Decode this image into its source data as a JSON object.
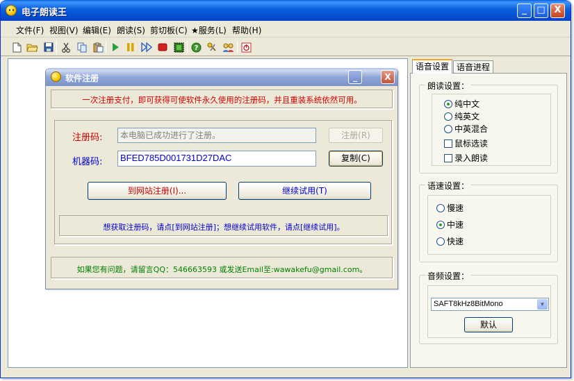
{
  "app": {
    "title": "电子朗读王",
    "window_buttons": [
      "_",
      "□",
      "X"
    ]
  },
  "menu": [
    "文件(F)",
    "视图(V)",
    "编辑(E)",
    "朗读(S)",
    "剪切板(C)",
    "★服务(L)",
    "帮助(H)"
  ],
  "toolbar": {
    "icons": [
      "new-file-icon",
      "open-folder-icon",
      "save-icon",
      "cut-icon",
      "copy-icon",
      "paste-icon",
      "play-icon",
      "pause-icon",
      "fast-forward-icon",
      "stop-icon",
      "record-icon",
      "help-icon",
      "tools-icon",
      "users-icon",
      "power-icon"
    ]
  },
  "right_panel": {
    "tabs": [
      "语音设置",
      "语音进程"
    ],
    "reading": {
      "title": "朗读设置：",
      "options": [
        "纯中文",
        "纯英文",
        "中英混合"
      ],
      "selected": "纯中文",
      "checkboxes": [
        "鼠标选读",
        "录入朗读"
      ]
    },
    "speed": {
      "title": "语速设置：",
      "options": [
        "慢速",
        "中速",
        "快速"
      ],
      "selected": "中速"
    },
    "audio": {
      "title": "音频设置：",
      "value": "SAFT8kHz8BitMono",
      "default_button": "默认"
    }
  },
  "dialog": {
    "title": "软件注册",
    "notice": "一次注册支付，即可获得可使软件永久使用的注册码，并且重装系统依然可用。",
    "reg_code_label": "注册码:",
    "reg_code_value": "本电脑已成功进行了注册。",
    "register_button": "注册(R)",
    "machine_code_label": "机器码:",
    "machine_code_value": "BFED785D001731D27DAC",
    "copy_button": "复制(C)",
    "website_button": "到网站注册(I)...",
    "trial_button": "继续试用(T)",
    "hint": "想获取注册码，请点[到网站注册]；想继续试用软件，请点[继续试用]。",
    "contact": "如果您有问题，请留言QQ：546663593   或发送Email至:wawakefu@gmail.com。"
  },
  "colors": {
    "notice_text": "#d40000",
    "label_red": "#cc0000",
    "label_blue": "#0000cc",
    "hint_text": "#0000cc",
    "contact_text": "#008000"
  }
}
